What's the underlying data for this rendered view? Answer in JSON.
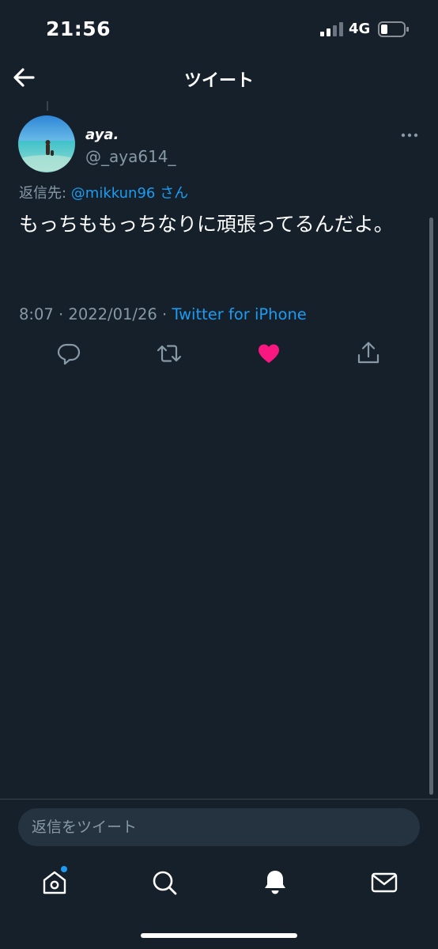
{
  "status_bar": {
    "time": "21:56",
    "network": "4G"
  },
  "header": {
    "title": "ツイート",
    "back_icon": "arrow-left-icon"
  },
  "tweet": {
    "author_name": "aya.",
    "author_handle": "@_aya614_",
    "reply_prefix": "返信先: ",
    "reply_to_user": "@mikkun96",
    "reply_suffix": " さん",
    "text": "もっちももっちなりに頑張ってるんだよ。",
    "time": "8:07",
    "date": "2022/01/26",
    "separator": " · ",
    "source": "Twitter for iPhone",
    "liked": true
  },
  "actions": {
    "reply_icon": "comment-icon",
    "retweet_icon": "retweet-icon",
    "like_icon": "heart-icon",
    "share_icon": "share-icon"
  },
  "reply_box": {
    "placeholder": "返信をツイート"
  },
  "tab_bar": {
    "items": [
      "home-icon",
      "search-icon",
      "notifications-icon",
      "messages-icon"
    ]
  },
  "colors": {
    "background": "#15202b",
    "accent": "#1d9bf0",
    "like": "#f91880",
    "secondary_text": "#8899a6"
  }
}
